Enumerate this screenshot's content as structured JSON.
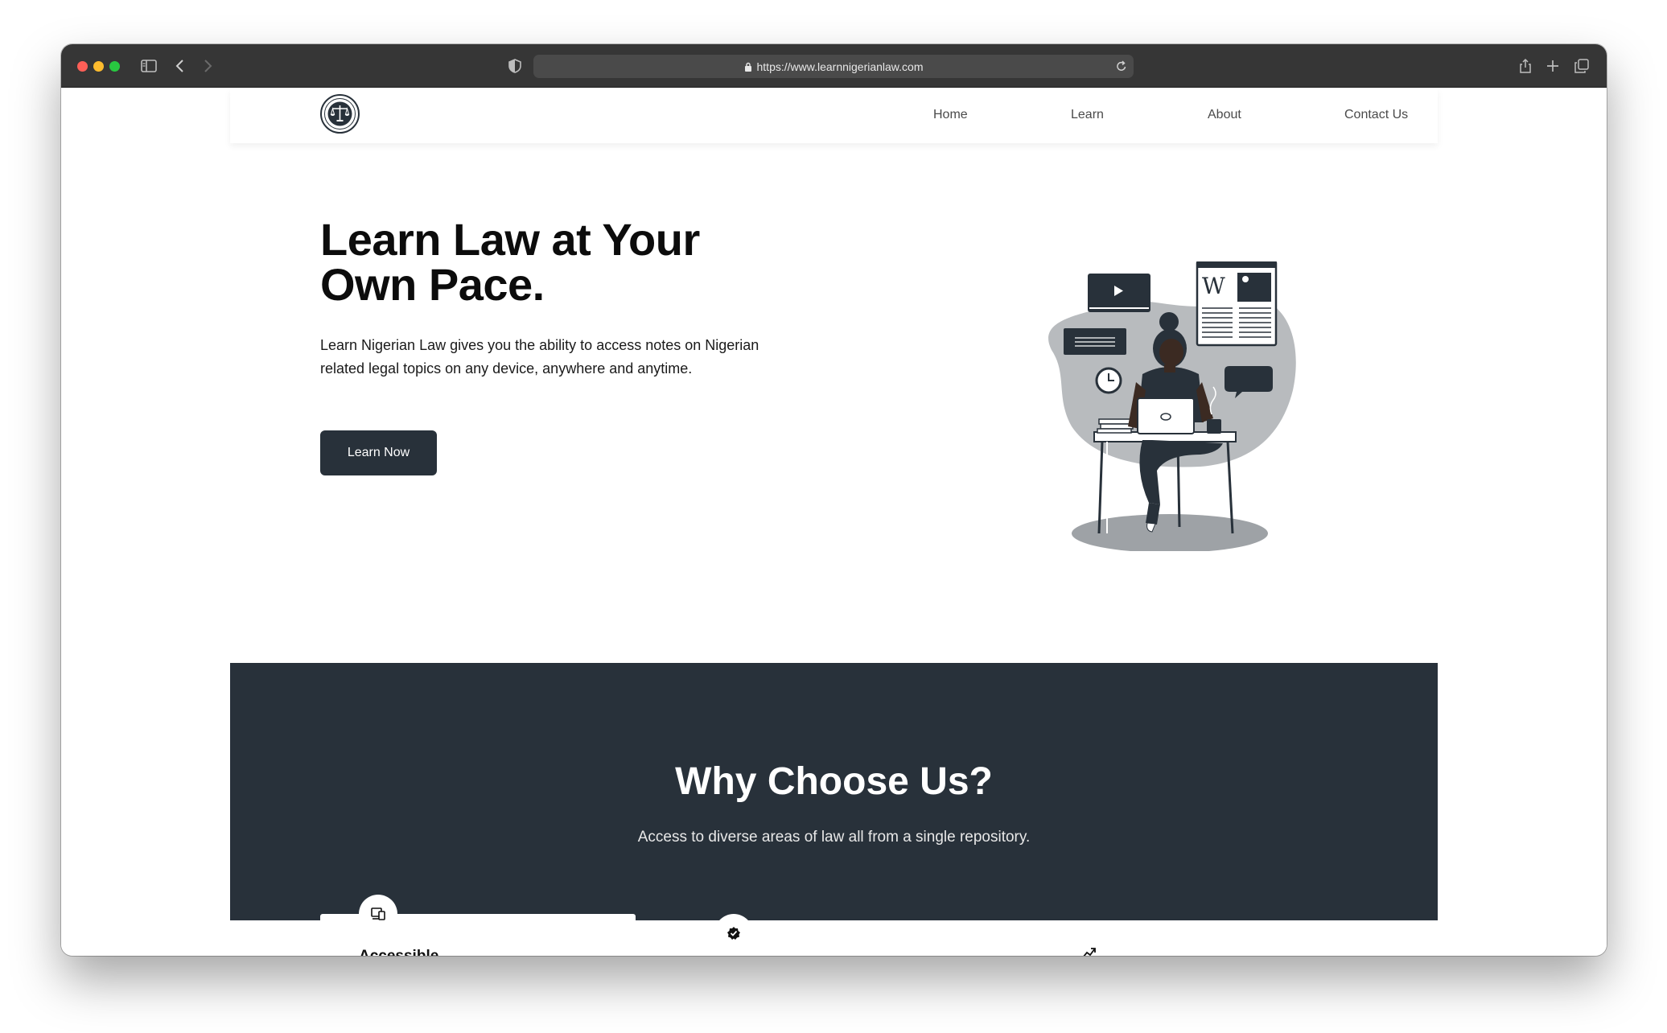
{
  "browser": {
    "url": "https://www.learnnigerianlaw.com"
  },
  "nav": {
    "items": [
      {
        "label": "Home"
      },
      {
        "label": "Learn"
      },
      {
        "label": "About"
      },
      {
        "label": "Contact Us"
      }
    ]
  },
  "hero": {
    "title_line1": "Learn Law at Your",
    "title_line2": "Own Pace.",
    "description": "Learn Nigerian Law gives you the ability to access notes on Nigerian related legal topics on any device, anywhere and anytime.",
    "cta_label": "Learn Now",
    "illustration_icon": "woman-studying-laptop-illustration"
  },
  "why": {
    "title": "Why Choose Us?",
    "subtitle": "Access to diverse areas of law all from a single repository.",
    "cards": [
      {
        "title": "Accessible",
        "icon": "devices-icon"
      },
      {
        "title": "",
        "icon": "check-badge-icon"
      },
      {
        "title": "",
        "icon": "trending-up-icon"
      }
    ]
  },
  "colors": {
    "primary_dark": "#28313a",
    "titlebar": "#363636",
    "text": "#0c0c0c"
  }
}
